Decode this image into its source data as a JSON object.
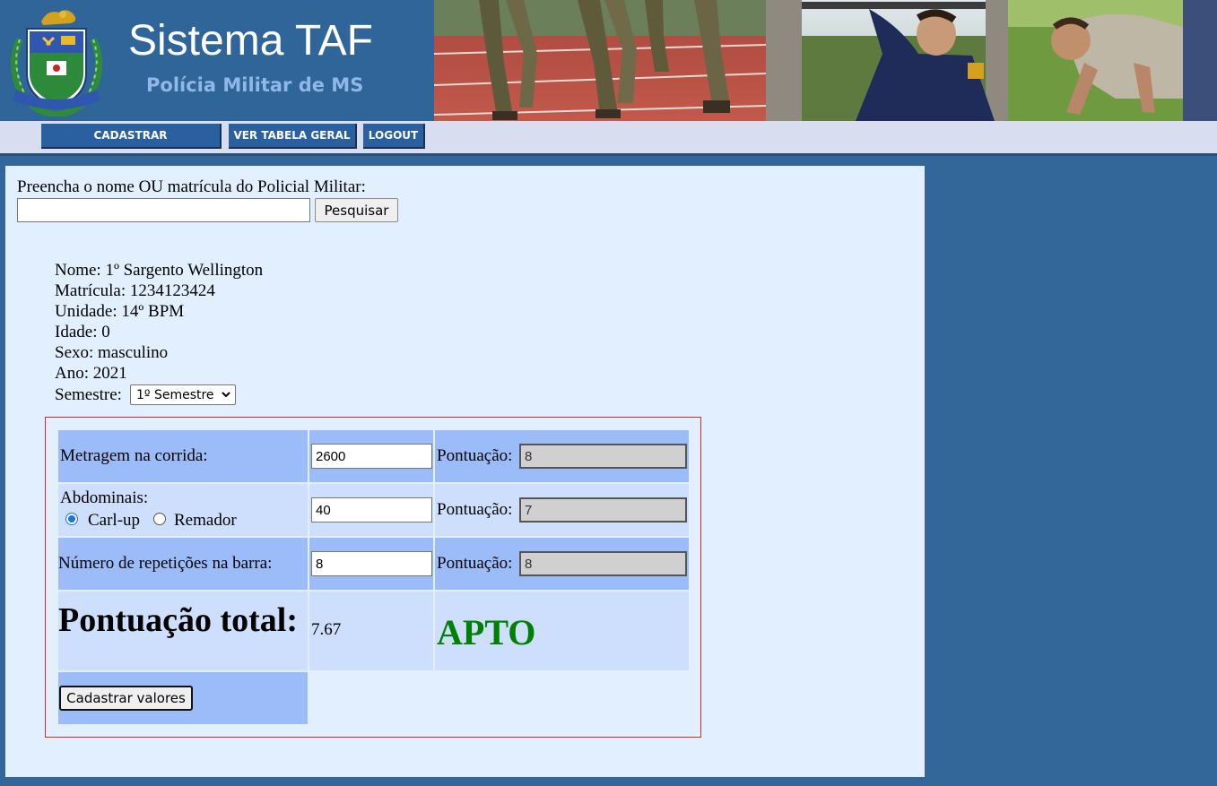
{
  "header": {
    "title": "Sistema TAF",
    "subtitle": "Polícia Militar de MS"
  },
  "nav": {
    "items": [
      {
        "label": "CADASTRAR"
      },
      {
        "label": "VER TABELA GERAL"
      },
      {
        "label": "LOGOUT"
      }
    ]
  },
  "search": {
    "label": "Preencha o nome OU matrícula do Policial Militar:",
    "value": "",
    "button": "Pesquisar"
  },
  "officer": {
    "nome": "Nome: 1º Sargento Wellington",
    "matricula": "Matrícula: 1234123424",
    "unidade": "Unidade: 14º BPM",
    "idade": "Idade: 0",
    "sexo": "Sexo: masculino",
    "ano": "Ano: 2021",
    "semestre_label": "Semestre:",
    "semestre_value": "1º Semestre"
  },
  "scores": {
    "pontuacao_label": "Pontuação:",
    "corrida": {
      "label": "Metragem na corrida:",
      "value": "2600",
      "pontuacao": "8"
    },
    "abdominais": {
      "label": "Abdominais:",
      "options": [
        "Carl-up",
        "Remador"
      ],
      "selected": "Carl-up",
      "value": "40",
      "pontuacao": "7"
    },
    "barra": {
      "label": "Número de repetições na barra:",
      "value": "8",
      "pontuacao": "8"
    },
    "total_label": "Pontuação total:",
    "total_value": "7.67",
    "status": "APTO",
    "status_color": "#008000",
    "submit": "Cadastrar valores"
  },
  "colors": {
    "page_bg": "#336699",
    "panel_bg": "#e1efff",
    "nav_button": "#2a60a0",
    "row_dark": "#9bbcf9",
    "row_light": "#cddffc",
    "box_border": "#d42a2a"
  }
}
